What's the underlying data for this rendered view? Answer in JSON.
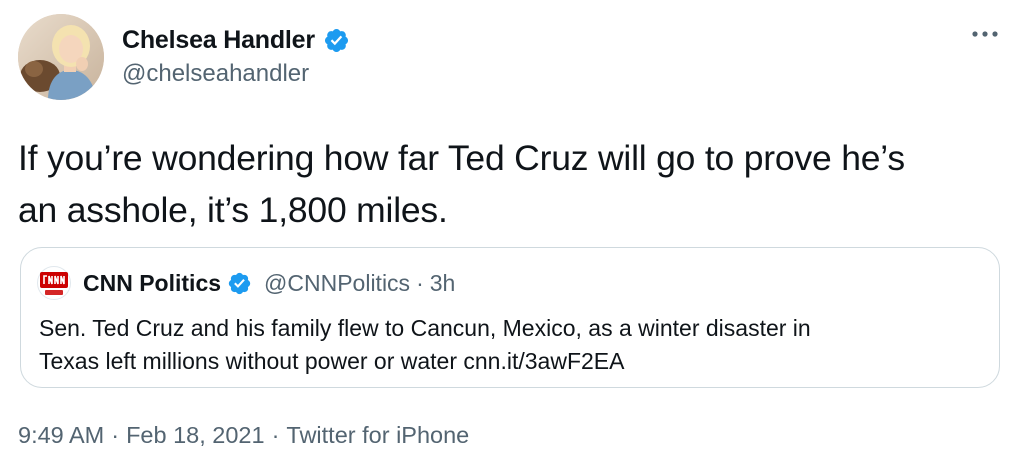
{
  "tweet": {
    "author": {
      "name": "Chelsea Handler",
      "handle": "@chelseahandler",
      "verified": true,
      "avatar_icon": "avatar-photo"
    },
    "more_icon": "more-icon",
    "text_line1": "If you’re wondering how far Ted Cruz will go to prove he’s",
    "text_line2": "an asshole, it’s 1,800 miles.",
    "quote": {
      "logo_icon": "cnn-politics-logo",
      "author": "CNN Politics",
      "handle": "@CNNPolitics",
      "separator": "·",
      "time": "3h",
      "text_line1": "Sen. Ted Cruz and his family flew to Cancun, Mexico, as a winter disaster in",
      "text_line2": "Texas left millions without power or water cnn.it/3awF2EA"
    },
    "meta": {
      "time": "9:49 AM",
      "dot1": "·",
      "date": "Feb 18, 2021",
      "dot2": "·",
      "source": "Twitter for iPhone"
    }
  },
  "colors": {
    "verified_blue": "#1d9bf0",
    "text_primary": "#0f1419",
    "text_secondary": "#536471",
    "border": "#cfd9de",
    "cnn_red": "#cc0000"
  }
}
